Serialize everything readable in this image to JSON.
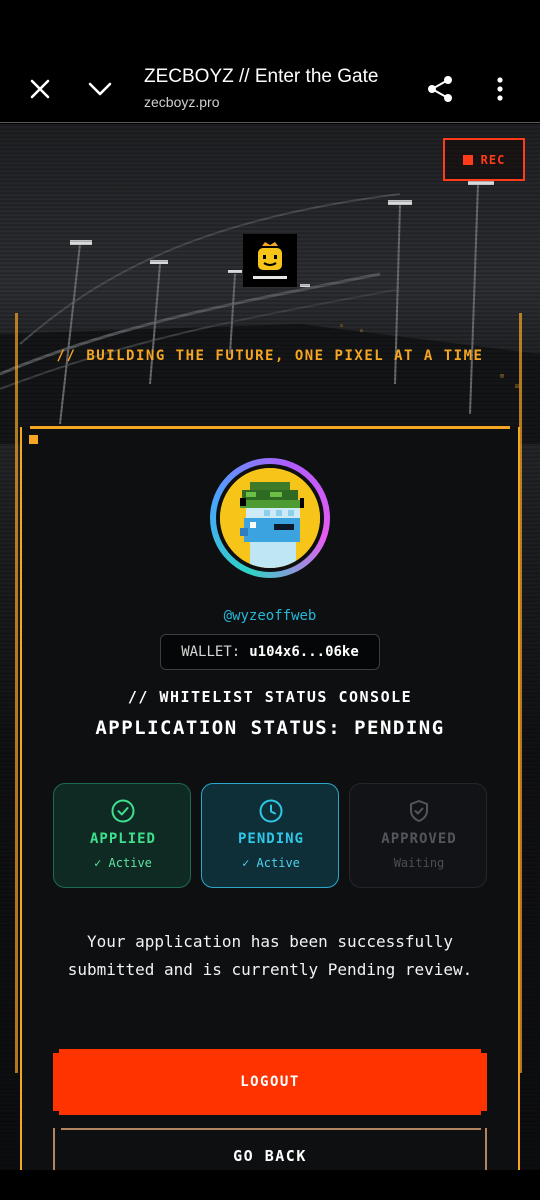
{
  "browser": {
    "title": "ZECBOYZ // Enter the Gate",
    "url": "zecboyz.pro",
    "icons": [
      "close-icon",
      "chevron-down-icon",
      "share-icon",
      "more-vert-icon"
    ]
  },
  "hero": {
    "rec_label": "REC",
    "tagline": "// BUILDING THE FUTURE, ONE PIXEL AT A TIME"
  },
  "profile": {
    "handle": "@wyzeoffweb",
    "wallet_label": "WALLET:",
    "wallet_value": "u104x6...06ke"
  },
  "console": {
    "title": "// WHITELIST STATUS CONSOLE",
    "status_heading": "APPLICATION STATUS: PENDING"
  },
  "steps": [
    {
      "label": "APPLIED",
      "sub": "✓ Active",
      "icon": "check-circle-icon",
      "state": "done",
      "color": "#3ee08f"
    },
    {
      "label": "PENDING",
      "sub": "✓ Active",
      "icon": "clock-icon",
      "state": "current",
      "color": "#2fc7e6"
    },
    {
      "label": "APPROVED",
      "sub": "Waiting",
      "icon": "shield-check-icon",
      "state": "waiting",
      "color": "#52565c"
    }
  ],
  "message": "Your application has been successfully submitted and is currently Pending review.",
  "buttons": {
    "logout": "LOGOUT",
    "go_back": "GO BACK"
  },
  "colors": {
    "accent": "#f5a623",
    "danger": "#ff3300",
    "cyan": "#2fc7e6",
    "green": "#3ee08f"
  }
}
